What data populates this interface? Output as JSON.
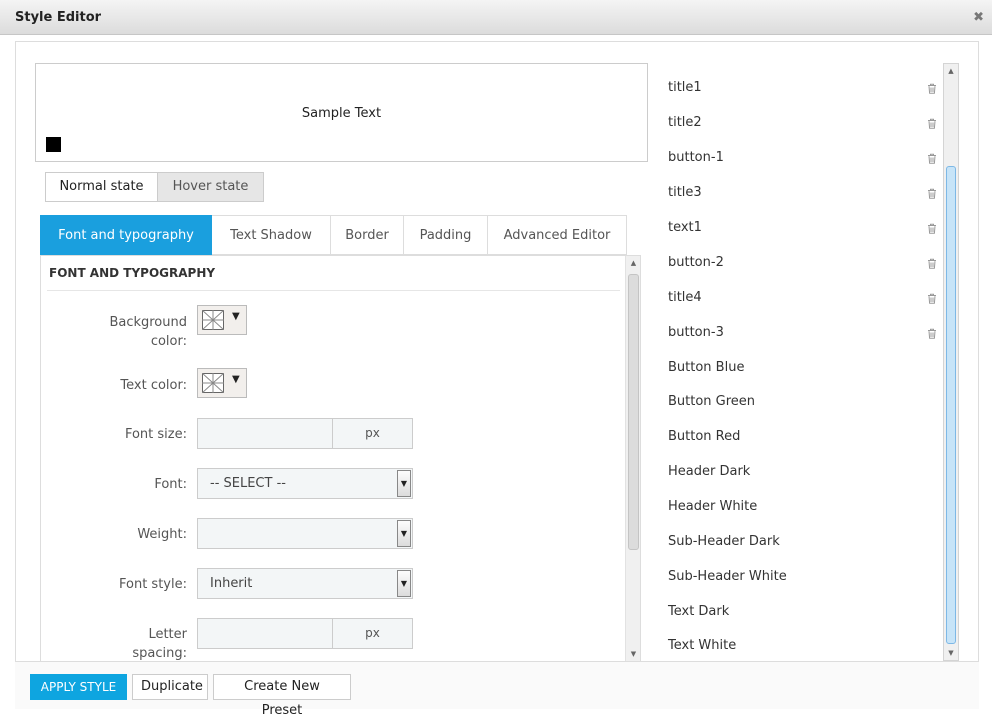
{
  "window": {
    "title": "Style Editor",
    "close_symbol": "✖"
  },
  "preview": {
    "sample_text": "Sample Text",
    "swatch_color": "#000000"
  },
  "states": {
    "normal": "Normal state",
    "hover": "Hover state",
    "active": "normal"
  },
  "tabs": [
    {
      "label": "Font and typography",
      "active": true
    },
    {
      "label": "Text Shadow",
      "active": false
    },
    {
      "label": "Border",
      "active": false
    },
    {
      "label": "Padding",
      "active": false
    },
    {
      "label": "Advanced Editor",
      "active": false
    }
  ],
  "section": {
    "title": "FONT AND TYPOGRAPHY",
    "fields": {
      "bg_color": {
        "label_line1": "Background",
        "label_line2": "color:"
      },
      "text_color": {
        "label": "Text color:"
      },
      "font_size": {
        "label": "Font size:",
        "value": "",
        "unit": "px"
      },
      "font": {
        "label": "Font:",
        "value": "-- SELECT --"
      },
      "weight": {
        "label": "Weight:",
        "value": ""
      },
      "font_style": {
        "label": "Font style:",
        "value": "Inherit"
      },
      "letter_spacing": {
        "label_line1": "Letter",
        "label_line2": "spacing:",
        "value": "",
        "unit": "px"
      }
    }
  },
  "presets": [
    {
      "name": "title1",
      "deletable": true
    },
    {
      "name": "title2",
      "deletable": true
    },
    {
      "name": "button-1",
      "deletable": true
    },
    {
      "name": "title3",
      "deletable": true
    },
    {
      "name": "text1",
      "deletable": true
    },
    {
      "name": "button-2",
      "deletable": true
    },
    {
      "name": "title4",
      "deletable": true
    },
    {
      "name": "button-3",
      "deletable": true
    },
    {
      "name": "Button Blue",
      "deletable": false
    },
    {
      "name": "Button Green",
      "deletable": false
    },
    {
      "name": "Button Red",
      "deletable": false
    },
    {
      "name": "Header Dark",
      "deletable": false
    },
    {
      "name": "Header White",
      "deletable": false
    },
    {
      "name": "Sub-Header Dark",
      "deletable": false
    },
    {
      "name": "Sub-Header White",
      "deletable": false
    },
    {
      "name": "Text Dark",
      "deletable": false
    },
    {
      "name": "Text White",
      "deletable": false
    }
  ],
  "footer": {
    "apply": "APPLY STYLE",
    "duplicate": "Duplicate",
    "new_preset": "Create New Preset"
  },
  "colors": {
    "accent": "#1a9fde",
    "apply_button": "#0ea5e0",
    "scroll_thumb": "#c7e4f8"
  }
}
